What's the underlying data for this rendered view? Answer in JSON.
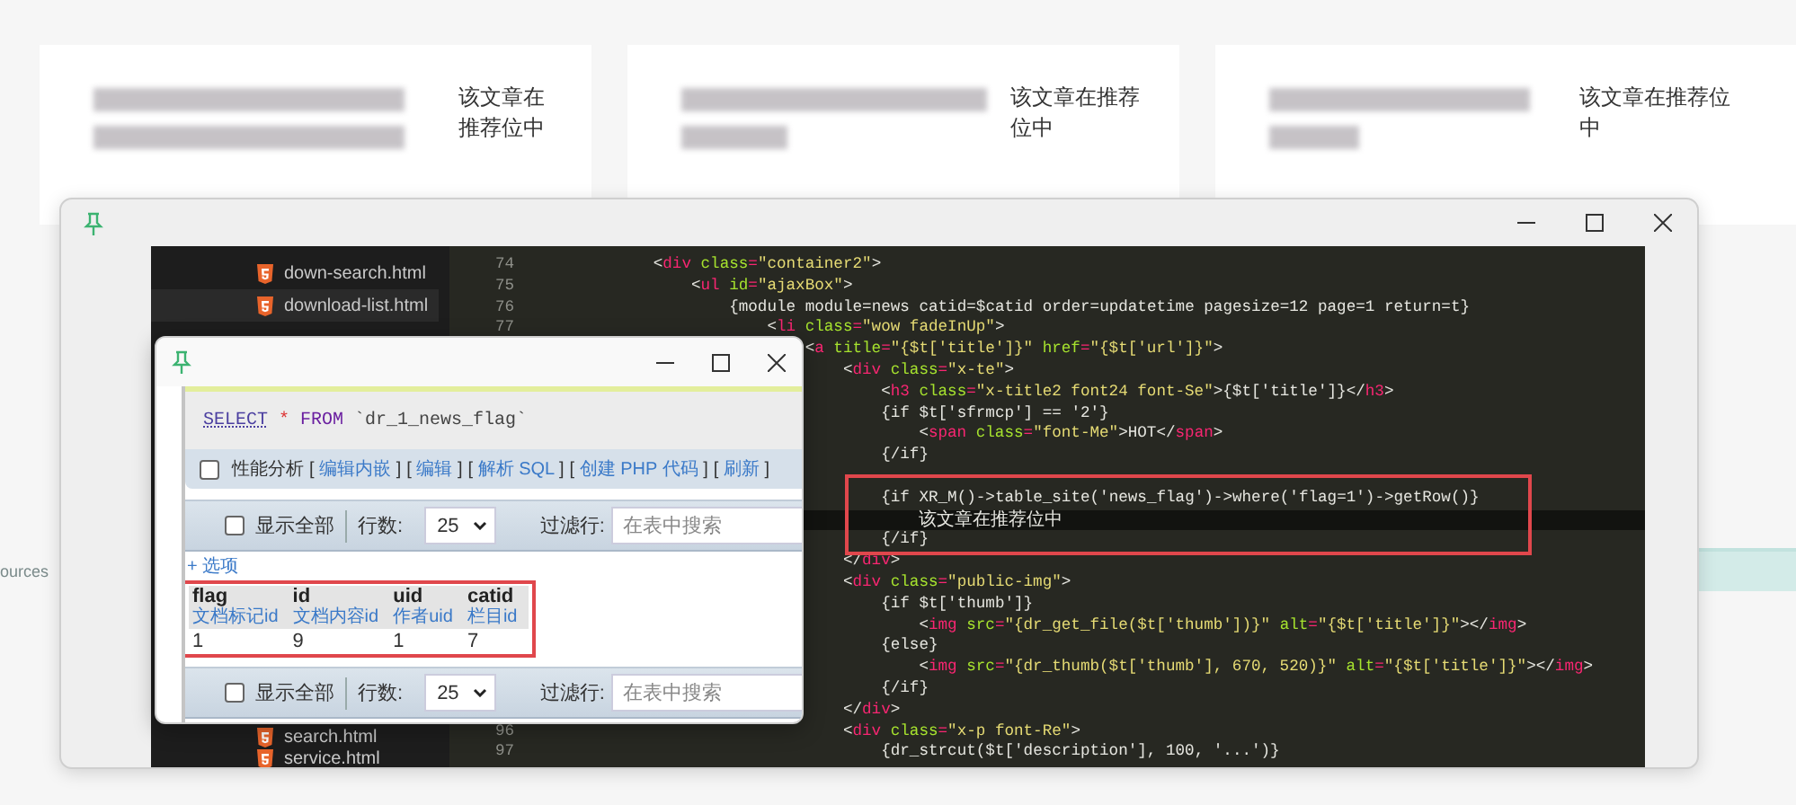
{
  "background_cards": [
    {
      "note": "该文章在推荐位中"
    },
    {
      "note": "该文章在推荐位中"
    },
    {
      "note": "该文章在推荐位中"
    }
  ],
  "background_fragment": "ources",
  "editor_window": {
    "file_tree": {
      "top_items": [
        {
          "name": "down-search.html",
          "selected": false
        },
        {
          "name": "download-list.html",
          "selected": true
        }
      ],
      "bottom_items": [
        {
          "name": "search.html",
          "selected": false
        },
        {
          "name": "service.html",
          "selected": false
        }
      ]
    },
    "code_lines": [
      {
        "number": "74",
        "text": "            <div class=\"container2\">",
        "current": false
      },
      {
        "number": "75",
        "text": "                <ul id=\"ajaxBox\">",
        "current": false
      },
      {
        "number": "76",
        "text": "                    {module module=news catid=$catid order=updatetime pagesize=12 page=1 return=t}",
        "current": false
      },
      {
        "number": "77",
        "text": "                        <li class=\"wow fadeInUp\">",
        "current": false
      },
      {
        "text": "                            <a title=\"{$t['title']}\" href=\"{$t['url']}\">",
        "current": false
      },
      {
        "text": "                                <div class=\"x-te\">",
        "current": false
      },
      {
        "text": "                                    <h3 class=\"x-title2 font24 font-Se\">{$t['title']}</h3>",
        "current": false
      },
      {
        "text": "                                    {if $t['sfrmcp'] == '2'}",
        "current": false
      },
      {
        "text": "                                        <span class=\"font-Me\">HOT</span>",
        "current": false
      },
      {
        "text": "                                    {/if}",
        "current": false
      },
      {
        "current": false
      },
      {
        "text": "                                    {if XR_M()->table_site('news_flag')->where('flag=1')->getRow()}",
        "current": false
      },
      {
        "text": "                                        该文章在推荐位中",
        "current": true
      },
      {
        "text": "                                    {/if}",
        "current": false
      },
      {
        "text": "                                </div>",
        "current": false
      },
      {
        "text": "                                <div class=\"public-img\">",
        "current": false
      },
      {
        "text": "                                    {if $t['thumb']}",
        "current": false
      },
      {
        "text": "                                        <img src=\"{dr_get_file($t['thumb'])}\" alt=\"{$t['title']}\"></img>",
        "current": false
      },
      {
        "text": "                                    {else}",
        "current": false
      },
      {
        "text": "                                        <img src=\"{dr_thumb($t['thumb'], 670, 520)}\" alt=\"{$t['title']}\"></img>",
        "current": false
      },
      {
        "text": "                                    {/if}",
        "current": false
      },
      {
        "text": "                                </div>",
        "current": false
      },
      {
        "number": "96",
        "text": "                                <div class=\"x-p font-Re\">",
        "current": false
      },
      {
        "number": "97",
        "text": "                                    {dr_strcut($t['description'], 100, '...')}",
        "current": false
      }
    ]
  },
  "sql_window": {
    "query_parts": [
      {
        "text": "SELECT",
        "kind": "keyword_link"
      },
      {
        "text": "*",
        "kind": "operator"
      },
      {
        "text": "FROM",
        "kind": "keyword"
      },
      {
        "text": "`dr_1_news_flag`",
        "kind": "identifier"
      }
    ],
    "profiling": {
      "label": "性能分析",
      "checked": false,
      "links": [
        {
          "before": "[",
          "label": "编辑内嵌",
          "after": "]"
        },
        {
          "before": "[",
          "label": "编辑",
          "after": "]"
        },
        {
          "before": "[",
          "label": "解析 SQL",
          "after": "]"
        },
        {
          "before": "[",
          "label": "创建 PHP 代码",
          "after": "]"
        },
        {
          "before": "[",
          "label": "刷新",
          "after": "]"
        }
      ]
    },
    "navbars": [
      {
        "show_all": "显示全部",
        "show_all_checked": false,
        "rows_label": "行数:",
        "rows_value": "25",
        "filter_label": "过滤行:",
        "filter_placeholder": "在表中搜索"
      },
      {
        "show_all": "显示全部",
        "show_all_checked": false,
        "rows_label": "行数:",
        "rows_value": "25",
        "filter_label": "过滤行:",
        "filter_placeholder": "在表中搜索"
      }
    ],
    "options_link": "+ 选项",
    "table": {
      "columns": [
        {
          "name": "flag",
          "comment": "文档标记id"
        },
        {
          "name": "id",
          "comment": "文档内容id"
        },
        {
          "name": "uid",
          "comment": "作者uid"
        },
        {
          "name": "catid",
          "comment": "栏目id"
        }
      ],
      "rows": [
        [
          "1",
          "9",
          "1",
          "7"
        ]
      ]
    }
  }
}
